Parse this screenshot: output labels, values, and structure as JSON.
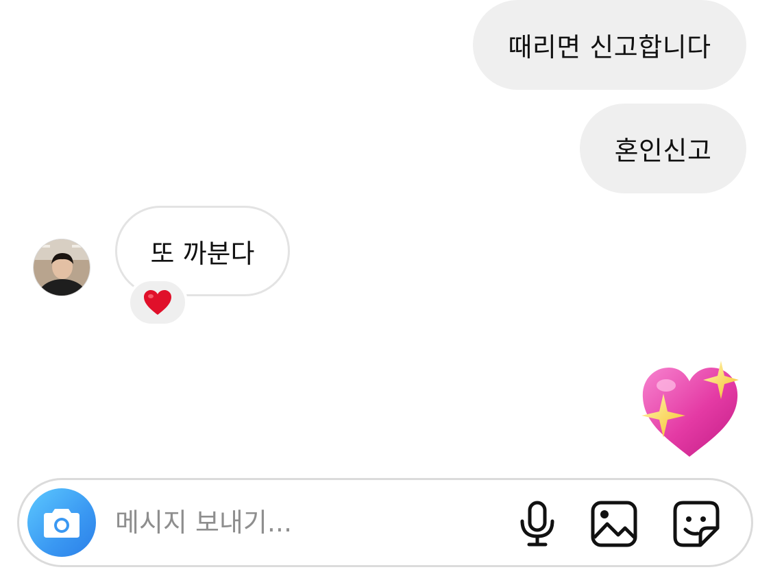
{
  "messages": [
    {
      "direction": "outgoing",
      "text": "때리면 신고합니다"
    },
    {
      "direction": "outgoing",
      "text": "혼인신고"
    },
    {
      "direction": "incoming",
      "text": "또 까분다",
      "reaction": "heart-emoji"
    },
    {
      "direction": "outgoing",
      "emoji": "sparkling-heart-emoji"
    }
  ],
  "composer": {
    "placeholder": "메시지 보내기...",
    "value": "",
    "icons": [
      "camera-icon",
      "microphone-icon",
      "gallery-icon",
      "sticker-icon"
    ]
  },
  "colors": {
    "outgoing_bubble": "#efefef",
    "incoming_border": "#e3e3e3",
    "camera_button": "#3a98f2",
    "reaction_heart": "#e0102a",
    "sparkle_heart": "#e84bb0"
  }
}
